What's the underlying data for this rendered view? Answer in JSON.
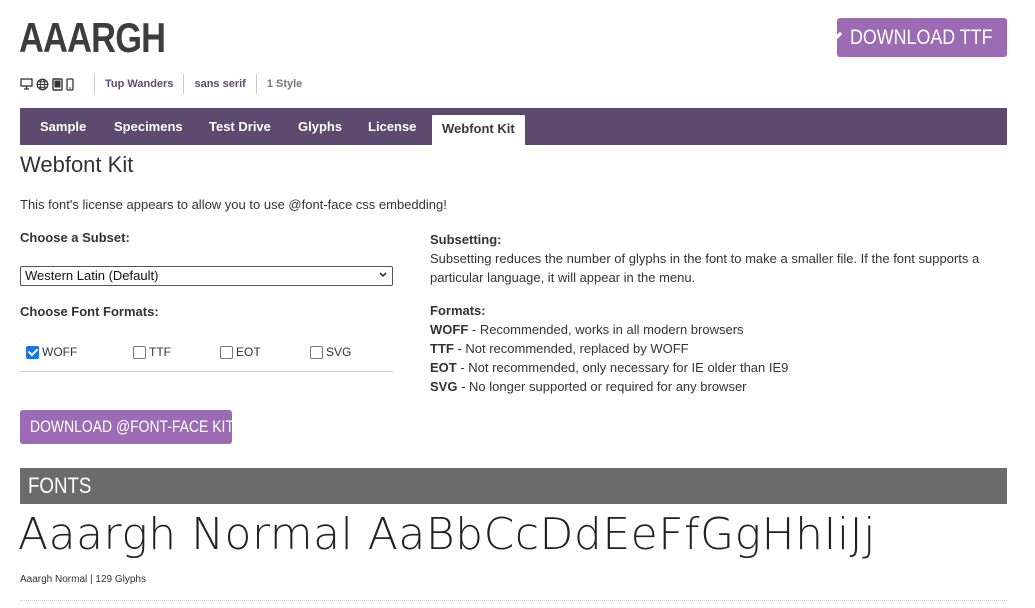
{
  "header": {
    "font_title": "AAARGH",
    "download_ttf_label": "DOWNLOAD TTF"
  },
  "meta": {
    "devices": [
      "desktop-icon",
      "globe-icon",
      "tablet-icon",
      "phone-icon"
    ],
    "designer": "Tup Wanders",
    "category": "sans serif",
    "styles": "1 Style"
  },
  "tabs": [
    {
      "label": "Sample"
    },
    {
      "label": "Specimens"
    },
    {
      "label": "Test Drive"
    },
    {
      "label": "Glyphs"
    },
    {
      "label": "License"
    },
    {
      "label": "Webfont Kit",
      "active": true
    }
  ],
  "main": {
    "heading": "Webfont Kit",
    "intro": "This font's license appears to allow you to use @font-face css embedding!",
    "subset_label": "Choose a Subset:",
    "subset_value": "Western Latin (Default)",
    "formats_label": "Choose Font Formats:",
    "formats": [
      {
        "label": "WOFF",
        "checked": true
      },
      {
        "label": "TTF",
        "checked": false
      },
      {
        "label": "EOT",
        "checked": false
      },
      {
        "label": "SVG",
        "checked": false
      }
    ],
    "download_kit_label": "DOWNLOAD @FONT-FACE KIT"
  },
  "info": {
    "subsetting_title": "Subsetting:",
    "subsetting_text": "Subsetting reduces the number of glyphs in the font to make a smaller file. If the font supports a particular language, it will appear in the menu.",
    "formats_title": "Formats:",
    "formats": [
      {
        "name": "WOFF",
        "desc": " - Recommended, works in all modern browsers"
      },
      {
        "name": "TTF",
        "desc": " - Not recommended, replaced by WOFF"
      },
      {
        "name": "EOT",
        "desc": " - Not recommended, only necessary for IE older than IE9"
      },
      {
        "name": "SVG",
        "desc": " - No longer supported or required for any browser"
      }
    ]
  },
  "fonts_section": {
    "title": "FONTS",
    "preview_text": "Aaargh Normal AaBbCcDdEeFfGgHhIiJj",
    "caption": "Aaargh Normal | 129 Glyphs"
  },
  "colors": {
    "accent": "#9b6bb4",
    "nav": "#5d4a6e",
    "section_bar": "#6b6b6b"
  }
}
